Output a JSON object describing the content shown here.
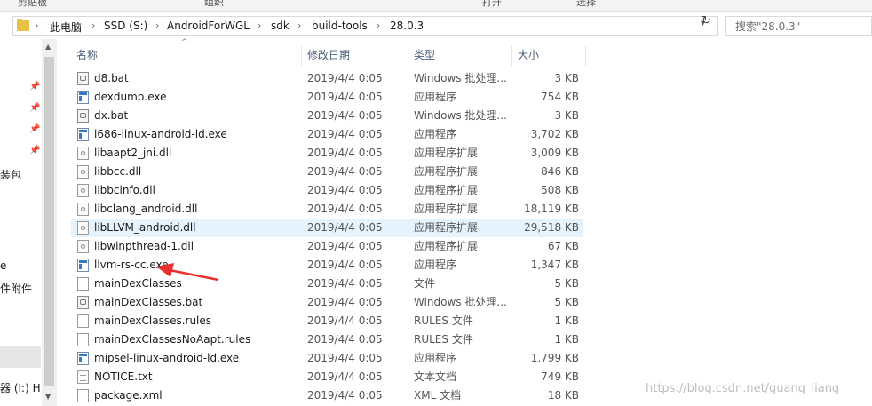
{
  "ribbon": {
    "group1": "剪贴板",
    "group2": "组织",
    "group3": "打开",
    "group4": "选择"
  },
  "address": {
    "crumbs": [
      "此电脑",
      "SSD (S:)",
      "AndroidForWGL",
      "sdk",
      "build-tools",
      "28.0.3"
    ],
    "search_placeholder": "搜索\"28.0.3\""
  },
  "nav": {
    "items": [
      "装包",
      "e",
      "件附件",
      "器 (I:) Hi"
    ]
  },
  "columns": {
    "name": "名称",
    "date": "修改日期",
    "type": "类型",
    "size": "大小"
  },
  "files": [
    {
      "name": "d8.bat",
      "date": "2019/4/4 0:05",
      "type": "Windows 批处理...",
      "size": "3 KB",
      "icon": "bat-file-icon"
    },
    {
      "name": "dexdump.exe",
      "date": "2019/4/4 0:05",
      "type": "应用程序",
      "size": "754 KB",
      "icon": "exe-file-icon"
    },
    {
      "name": "dx.bat",
      "date": "2019/4/4 0:05",
      "type": "Windows 批处理...",
      "size": "3 KB",
      "icon": "bat-file-icon"
    },
    {
      "name": "i686-linux-android-ld.exe",
      "date": "2019/4/4 0:05",
      "type": "应用程序",
      "size": "3,702 KB",
      "icon": "exe-file-icon"
    },
    {
      "name": "libaapt2_jni.dll",
      "date": "2019/4/4 0:05",
      "type": "应用程序扩展",
      "size": "3,009 KB",
      "icon": "dll-file-icon"
    },
    {
      "name": "libbcc.dll",
      "date": "2019/4/4 0:05",
      "type": "应用程序扩展",
      "size": "846 KB",
      "icon": "dll-file-icon"
    },
    {
      "name": "libbcinfo.dll",
      "date": "2019/4/4 0:05",
      "type": "应用程序扩展",
      "size": "508 KB",
      "icon": "dll-file-icon"
    },
    {
      "name": "libclang_android.dll",
      "date": "2019/4/4 0:05",
      "type": "应用程序扩展",
      "size": "18,119 KB",
      "icon": "dll-file-icon"
    },
    {
      "name": "libLLVM_android.dll",
      "date": "2019/4/4 0:05",
      "type": "应用程序扩展",
      "size": "29,518 KB",
      "icon": "dll-file-icon"
    },
    {
      "name": "libwinpthread-1.dll",
      "date": "2019/4/4 0:05",
      "type": "应用程序扩展",
      "size": "67 KB",
      "icon": "dll-file-icon"
    },
    {
      "name": "llvm-rs-cc.exe",
      "date": "2019/4/4 0:05",
      "type": "应用程序",
      "size": "1,347 KB",
      "icon": "exe-file-icon"
    },
    {
      "name": "mainDexClasses",
      "date": "2019/4/4 0:05",
      "type": "文件",
      "size": "5 KB",
      "icon": "blank-file-icon"
    },
    {
      "name": "mainDexClasses.bat",
      "date": "2019/4/4 0:05",
      "type": "Windows 批处理...",
      "size": "5 KB",
      "icon": "bat-file-icon"
    },
    {
      "name": "mainDexClasses.rules",
      "date": "2019/4/4 0:05",
      "type": "RULES 文件",
      "size": "1 KB",
      "icon": "blank-file-icon"
    },
    {
      "name": "mainDexClassesNoAapt.rules",
      "date": "2019/4/4 0:05",
      "type": "RULES 文件",
      "size": "1 KB",
      "icon": "blank-file-icon"
    },
    {
      "name": "mipsel-linux-android-ld.exe",
      "date": "2019/4/4 0:05",
      "type": "应用程序",
      "size": "1,799 KB",
      "icon": "exe-file-icon"
    },
    {
      "name": "NOTICE.txt",
      "date": "2019/4/4 0:05",
      "type": "文本文档",
      "size": "749 KB",
      "icon": "text-file-icon"
    },
    {
      "name": "package.xml",
      "date": "2019/4/4 0:05",
      "type": "XML 文档",
      "size": "18 KB",
      "icon": "xml-file-icon"
    }
  ],
  "selected_row": 8,
  "watermark": "https://blog.csdn.net/guang_liang_",
  "colors": {
    "selection": "#e5f3ff",
    "header_text": "#4c607a",
    "annotation_arrow": "#e8312f"
  }
}
